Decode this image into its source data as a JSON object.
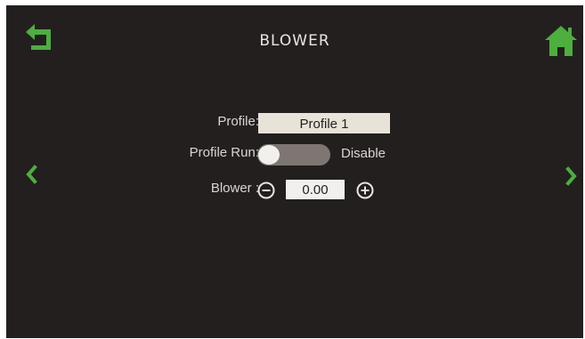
{
  "header": {
    "title": "BLOWER",
    "back_icon": "back-arrow-icon",
    "home_icon": "home-icon"
  },
  "navigation": {
    "prev_icon": "chevron-left-icon",
    "next_icon": "chevron-right-icon"
  },
  "form": {
    "profile": {
      "label": "Profile:",
      "value": "Profile 1"
    },
    "profile_run": {
      "label": "Profile Run:",
      "state": "Disable",
      "enabled": false
    },
    "blower": {
      "label": "Blower :",
      "value": "0.00",
      "decrease_icon": "minus-circle-icon",
      "increase_icon": "plus-circle-icon"
    }
  },
  "colors": {
    "background": "#231f1f",
    "accent": "#4caf3e",
    "text": "#d8d6d2"
  }
}
